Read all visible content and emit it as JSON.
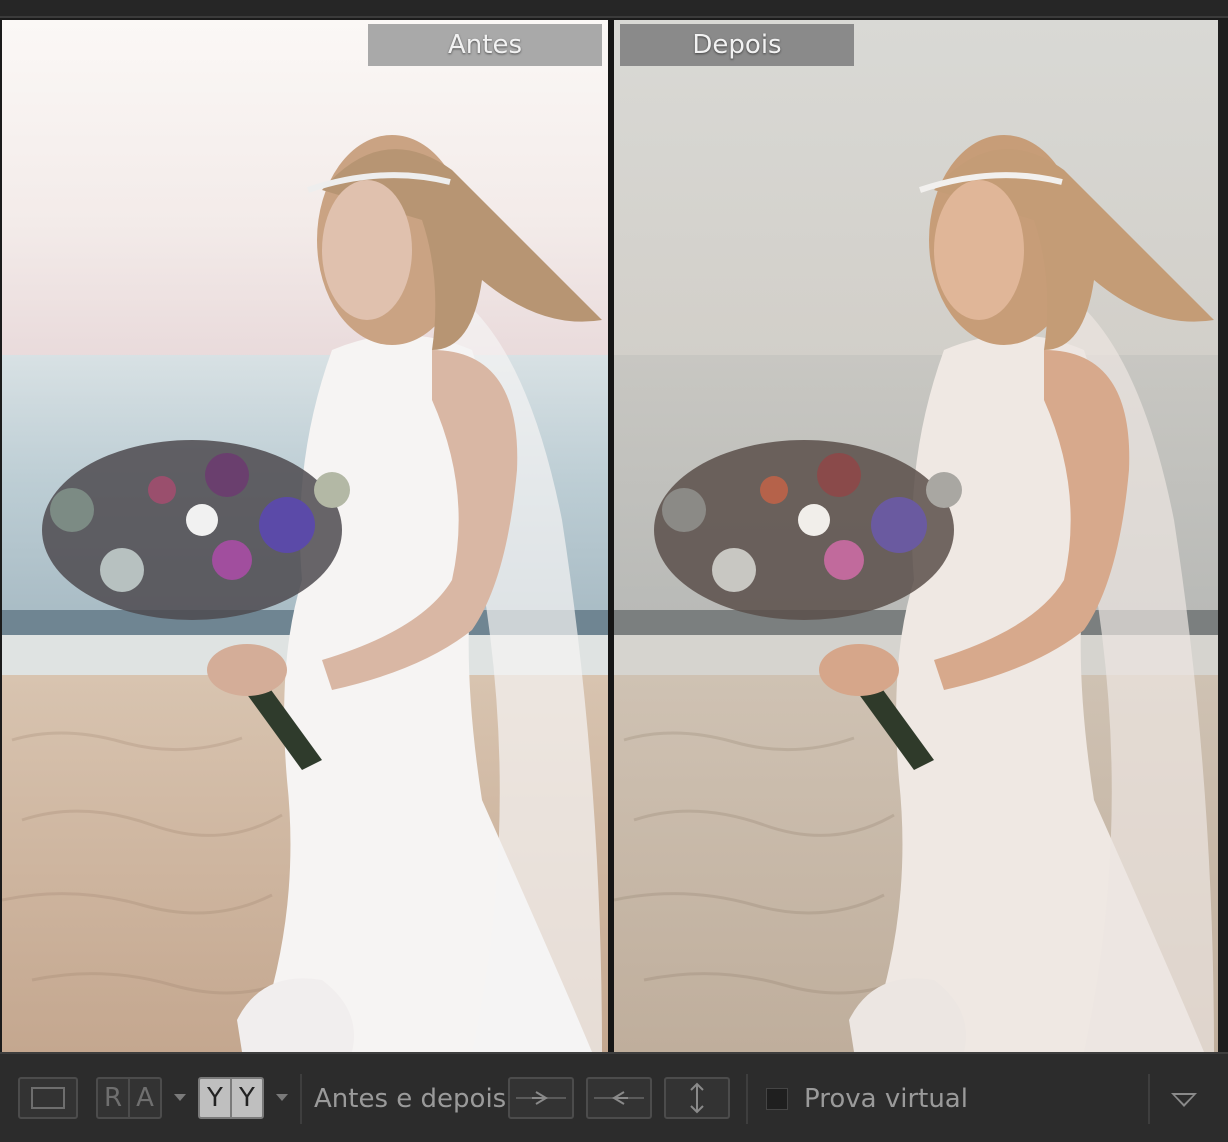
{
  "panes": {
    "before_label": "Antes",
    "after_label": "Depois"
  },
  "toolbar": {
    "view_compare_left": "R",
    "view_compare_right": "A",
    "view_split_left": "Y",
    "view_split_right": "Y",
    "before_after_label": "Antes e depois:",
    "soft_proof_label": "Prova virtual",
    "soft_proof_checked": false
  },
  "colors": {
    "before_sky": "#f7f2f0",
    "after_sky": "#d9d8d2",
    "accent_active": "#bfbfbf"
  }
}
